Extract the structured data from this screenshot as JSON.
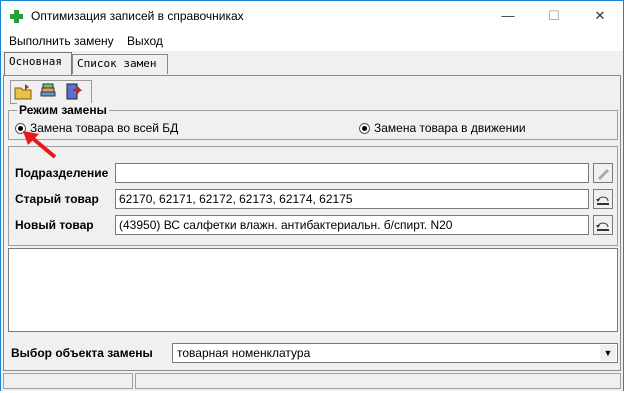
{
  "window": {
    "title": "Оптимизация записей в справочниках",
    "minimize": "—",
    "maximize": "☐",
    "close": "✕"
  },
  "menu": {
    "items": [
      "Выполнить замену",
      "Выход"
    ]
  },
  "tabs": [
    {
      "label": "Основная",
      "active": true
    },
    {
      "label": "Список замен",
      "active": false
    }
  ],
  "toolbar": {
    "buttons": [
      "open-folder-icon",
      "stack-icon",
      "exit-door-icon"
    ]
  },
  "mode": {
    "title": "Режим замены",
    "option_all": "Замена товара во всей БД",
    "option_movement": "Замена товара в движении",
    "selected": "option_all"
  },
  "fields": {
    "subdivision_label": "Подразделение",
    "subdivision_value": "",
    "old_label": "Старый товар",
    "old_value": "62170, 62171, 62172, 62173, 62174, 62175",
    "new_label": "Новый товар",
    "new_value": "(43950) ВС салфетки влажн. антибактериальн. б/спирт. N20"
  },
  "bottom": {
    "label": "Выбор объекта замены",
    "select_value": "товарная номенклатура"
  },
  "colors": {
    "accent": "#1883d7",
    "annotation_arrow": "#e8191b"
  }
}
